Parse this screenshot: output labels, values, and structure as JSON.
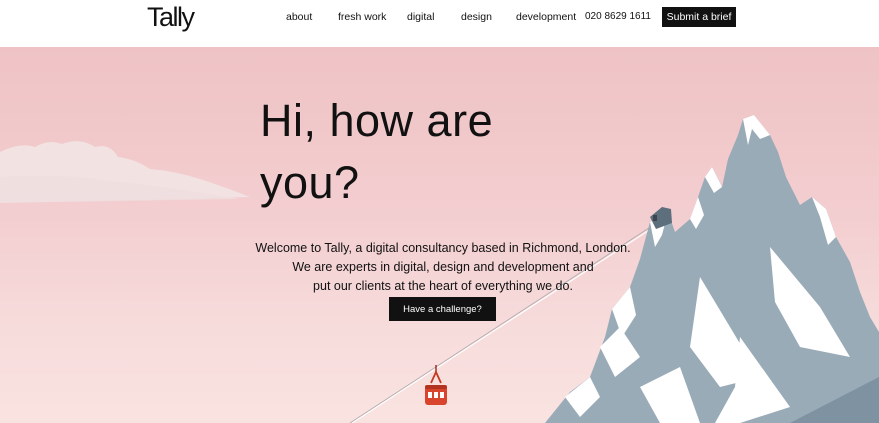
{
  "brand": {
    "logo_text": "Tally"
  },
  "nav": {
    "items": [
      {
        "label": "about"
      },
      {
        "label": "fresh work"
      },
      {
        "label": "digital"
      },
      {
        "label": "design"
      },
      {
        "label": "development"
      }
    ],
    "phone": "020 8629 1611",
    "cta_label": "Submit a brief"
  },
  "hero": {
    "headline": "Hi, how are you?",
    "intro_lines": [
      "Welcome to Tally, a digital consultancy based in Richmond, London.",
      "We are experts in digital, design and development and",
      "put our clients at the heart of everything we do."
    ],
    "cta_label": "Have a challenge?"
  },
  "colors": {
    "background_top": "#efc3c5",
    "background_bottom": "#f9e3e0",
    "mountain": "#9aabb8",
    "snow": "#ffffff",
    "gondola": "#d9442c",
    "button": "#111111"
  },
  "illustration": {
    "elements": [
      "cloud",
      "mountain",
      "cable-car-line",
      "gondola",
      "cable-station"
    ]
  }
}
